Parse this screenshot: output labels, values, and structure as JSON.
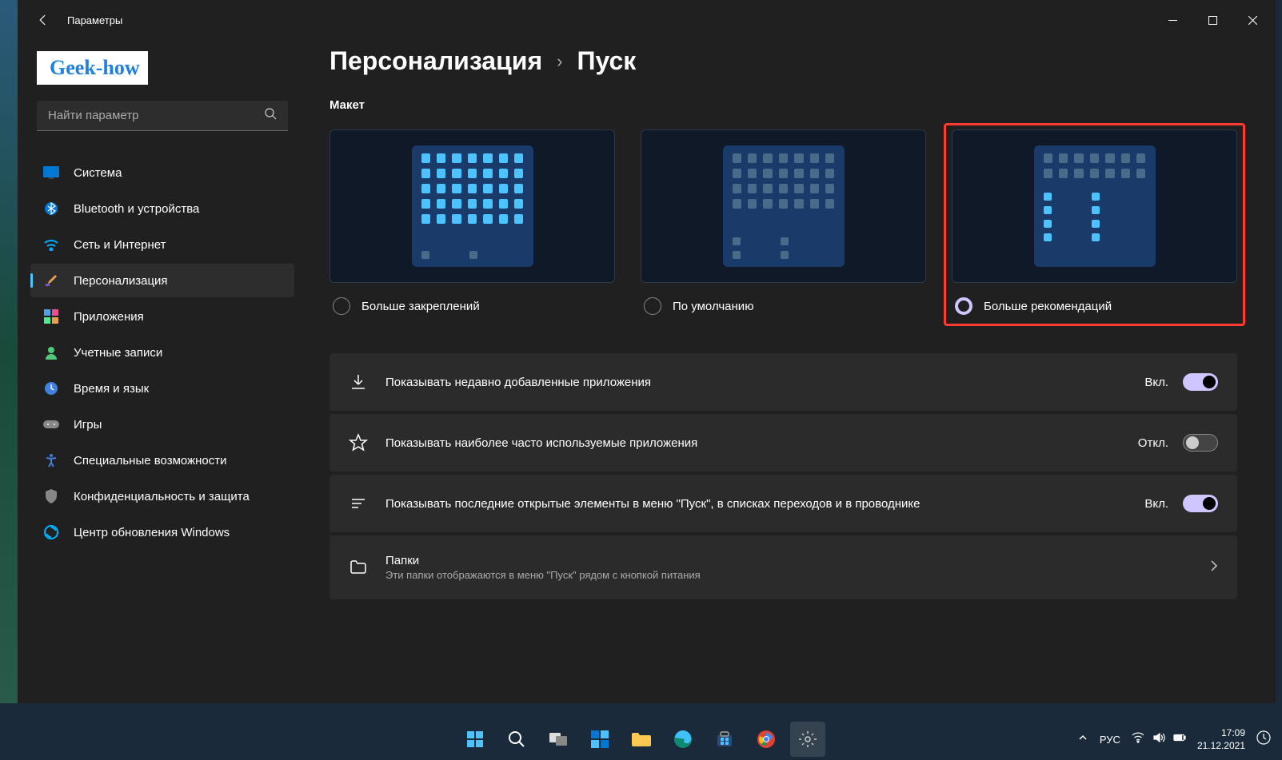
{
  "window": {
    "title": "Параметры"
  },
  "user": {
    "logo_text": "Geek-how"
  },
  "search": {
    "placeholder": "Найти параметр"
  },
  "nav": {
    "items": [
      {
        "label": "Система",
        "icon": "display"
      },
      {
        "label": "Bluetooth и устройства",
        "icon": "bluetooth"
      },
      {
        "label": "Сеть и Интернет",
        "icon": "wifi"
      },
      {
        "label": "Персонализация",
        "icon": "brush",
        "active": true
      },
      {
        "label": "Приложения",
        "icon": "apps"
      },
      {
        "label": "Учетные записи",
        "icon": "person"
      },
      {
        "label": "Время и язык",
        "icon": "clock"
      },
      {
        "label": "Игры",
        "icon": "gamepad"
      },
      {
        "label": "Специальные возможности",
        "icon": "accessibility"
      },
      {
        "label": "Конфиденциальность и защита",
        "icon": "shield"
      },
      {
        "label": "Центр обновления Windows",
        "icon": "update"
      }
    ]
  },
  "breadcrumb": {
    "parent": "Персонализация",
    "current": "Пуск"
  },
  "layout": {
    "label": "Макет",
    "options": [
      {
        "label": "Больше закреплений",
        "selected": false
      },
      {
        "label": "По умолчанию",
        "selected": false
      },
      {
        "label": "Больше рекомендаций",
        "selected": true,
        "highlighted": true
      }
    ]
  },
  "settings": [
    {
      "icon": "download",
      "title": "Показывать недавно добавленные приложения",
      "state_label": "Вкл.",
      "on": true
    },
    {
      "icon": "star",
      "title": "Показывать наиболее часто используемые приложения",
      "state_label": "Откл.",
      "on": false
    },
    {
      "icon": "list",
      "title": "Показывать последние открытые элементы в меню \"Пуск\", в списках переходов и в проводнике",
      "state_label": "Вкл.",
      "on": true
    },
    {
      "icon": "folder",
      "title": "Папки",
      "sub": "Эти папки отображаются в меню \"Пуск\" рядом с кнопкой питания",
      "nav": true
    }
  ],
  "taskbar": {
    "lang": "РУС",
    "time": "17:09",
    "date": "21.12.2021"
  }
}
